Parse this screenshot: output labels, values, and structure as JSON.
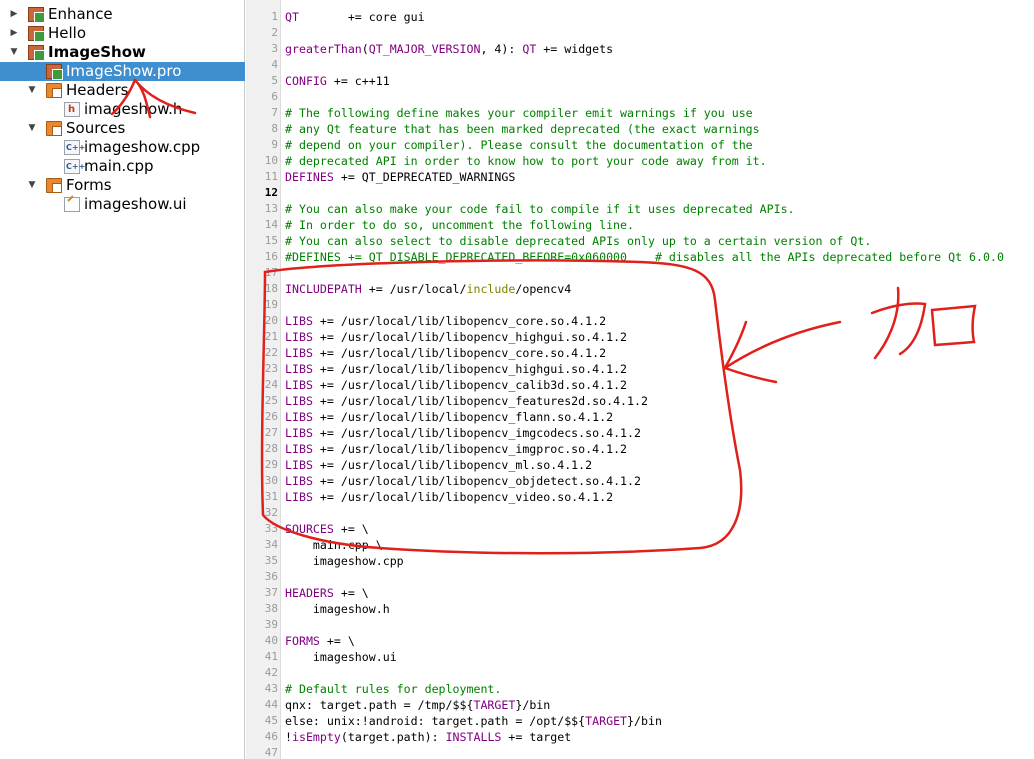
{
  "project_tree": {
    "items": [
      {
        "label": "Enhance",
        "level": 0,
        "icon": "qt-project-icon",
        "state": "collapsed",
        "bold": false,
        "selected": false
      },
      {
        "label": "Hello",
        "level": 0,
        "icon": "qt-project-icon",
        "state": "collapsed",
        "bold": false,
        "selected": false
      },
      {
        "label": "ImageShow",
        "level": 0,
        "icon": "qt-project-icon",
        "state": "expanded",
        "bold": true,
        "selected": false
      },
      {
        "label": "ImageShow.pro",
        "level": 1,
        "icon": "pro-file-icon",
        "state": "leaf",
        "bold": false,
        "selected": true
      },
      {
        "label": "Headers",
        "level": 1,
        "icon": "headers-folder-icon",
        "state": "expanded",
        "bold": false,
        "selected": false
      },
      {
        "label": "imageshow.h",
        "level": 2,
        "icon": "header-file-icon",
        "state": "leaf",
        "bold": false,
        "selected": false
      },
      {
        "label": "Sources",
        "level": 1,
        "icon": "sources-folder-icon",
        "state": "expanded",
        "bold": false,
        "selected": false
      },
      {
        "label": "imageshow.cpp",
        "level": 2,
        "icon": "cpp-file-icon",
        "state": "leaf",
        "bold": false,
        "selected": false
      },
      {
        "label": "main.cpp",
        "level": 2,
        "icon": "cpp-file-icon",
        "state": "leaf",
        "bold": false,
        "selected": false
      },
      {
        "label": "Forms",
        "level": 1,
        "icon": "forms-folder-icon",
        "state": "expanded",
        "bold": false,
        "selected": false
      },
      {
        "label": "imageshow.ui",
        "level": 2,
        "icon": "ui-file-icon",
        "state": "leaf",
        "bold": false,
        "selected": false
      }
    ]
  },
  "editor": {
    "current_line": 12,
    "lines": [
      {
        "n": "1",
        "t": [
          [
            "k",
            "QT"
          ],
          [
            "n",
            "       += core gui"
          ]
        ]
      },
      {
        "n": "2",
        "t": []
      },
      {
        "n": "3",
        "t": [
          [
            "k",
            "greaterThan"
          ],
          [
            "n",
            "("
          ],
          [
            "k",
            "QT_MAJOR_VERSION"
          ],
          [
            "n",
            ", 4): "
          ],
          [
            "k",
            "QT"
          ],
          [
            "n",
            " += widgets"
          ]
        ]
      },
      {
        "n": "4",
        "t": []
      },
      {
        "n": "5",
        "t": [
          [
            "k",
            "CONFIG"
          ],
          [
            "n",
            " += c++11"
          ]
        ]
      },
      {
        "n": "6",
        "t": []
      },
      {
        "n": "7",
        "t": [
          [
            "c",
            "# The following define makes your compiler emit warnings if you use"
          ]
        ]
      },
      {
        "n": "8",
        "t": [
          [
            "c",
            "# any Qt feature that has been marked deprecated (the exact warnings"
          ]
        ]
      },
      {
        "n": "9",
        "t": [
          [
            "c",
            "# depend on your compiler). Please consult the documentation of the"
          ]
        ]
      },
      {
        "n": "10",
        "t": [
          [
            "c",
            "# deprecated API in order to know how to port your code away from it."
          ]
        ]
      },
      {
        "n": "11",
        "t": [
          [
            "k",
            "DEFINES"
          ],
          [
            "n",
            " += QT_DEPRECATED_WARNINGS"
          ]
        ]
      },
      {
        "n": "12",
        "t": []
      },
      {
        "n": "13",
        "t": [
          [
            "c",
            "# You can also make your code fail to compile if it uses deprecated APIs."
          ]
        ]
      },
      {
        "n": "14",
        "t": [
          [
            "c",
            "# In order to do so, uncomment the following line."
          ]
        ]
      },
      {
        "n": "15",
        "t": [
          [
            "c",
            "# You can also select to disable deprecated APIs only up to a certain version of Qt."
          ]
        ]
      },
      {
        "n": "16",
        "t": [
          [
            "c",
            "#DEFINES += QT_DISABLE_DEPRECATED_BEFORE=0x060000    # disables all the APIs deprecated before Qt 6.0.0"
          ]
        ]
      },
      {
        "n": "17",
        "t": []
      },
      {
        "n": "18",
        "t": [
          [
            "k",
            "INCLUDEPATH"
          ],
          [
            "n",
            " += /usr/local/"
          ],
          [
            "m",
            "include"
          ],
          [
            "n",
            "/opencv4"
          ]
        ]
      },
      {
        "n": "19",
        "t": []
      },
      {
        "n": "20",
        "t": [
          [
            "k",
            "LIBS"
          ],
          [
            "n",
            " += /usr/local/lib/libopencv_core.so.4.1.2"
          ]
        ]
      },
      {
        "n": "21",
        "t": [
          [
            "k",
            "LIBS"
          ],
          [
            "n",
            " += /usr/local/lib/libopencv_highgui.so.4.1.2"
          ]
        ]
      },
      {
        "n": "22",
        "t": [
          [
            "k",
            "LIBS"
          ],
          [
            "n",
            " += /usr/local/lib/libopencv_core.so.4.1.2"
          ]
        ]
      },
      {
        "n": "23",
        "t": [
          [
            "k",
            "LIBS"
          ],
          [
            "n",
            " += /usr/local/lib/libopencv_highgui.so.4.1.2"
          ]
        ]
      },
      {
        "n": "24",
        "t": [
          [
            "k",
            "LIBS"
          ],
          [
            "n",
            " += /usr/local/lib/libopencv_calib3d.so.4.1.2"
          ]
        ]
      },
      {
        "n": "25",
        "t": [
          [
            "k",
            "LIBS"
          ],
          [
            "n",
            " += /usr/local/lib/libopencv_features2d.so.4.1.2"
          ]
        ]
      },
      {
        "n": "26",
        "t": [
          [
            "k",
            "LIBS"
          ],
          [
            "n",
            " += /usr/local/lib/libopencv_flann.so.4.1.2"
          ]
        ]
      },
      {
        "n": "27",
        "t": [
          [
            "k",
            "LIBS"
          ],
          [
            "n",
            " += /usr/local/lib/libopencv_imgcodecs.so.4.1.2"
          ]
        ]
      },
      {
        "n": "28",
        "t": [
          [
            "k",
            "LIBS"
          ],
          [
            "n",
            " += /usr/local/lib/libopencv_imgproc.so.4.1.2"
          ]
        ]
      },
      {
        "n": "29",
        "t": [
          [
            "k",
            "LIBS"
          ],
          [
            "n",
            " += /usr/local/lib/libopencv_ml.so.4.1.2"
          ]
        ]
      },
      {
        "n": "30",
        "t": [
          [
            "k",
            "LIBS"
          ],
          [
            "n",
            " += /usr/local/lib/libopencv_objdetect.so.4.1.2"
          ]
        ]
      },
      {
        "n": "31",
        "t": [
          [
            "k",
            "LIBS"
          ],
          [
            "n",
            " += /usr/local/lib/libopencv_video.so.4.1.2"
          ]
        ]
      },
      {
        "n": "32",
        "t": []
      },
      {
        "n": "33",
        "t": [
          [
            "k",
            "SOURCES"
          ],
          [
            "n",
            " += \\"
          ]
        ]
      },
      {
        "n": "34",
        "t": [
          [
            "n",
            "    main.cpp \\"
          ]
        ]
      },
      {
        "n": "35",
        "t": [
          [
            "n",
            "    imageshow.cpp"
          ]
        ]
      },
      {
        "n": "36",
        "t": []
      },
      {
        "n": "37",
        "t": [
          [
            "k",
            "HEADERS"
          ],
          [
            "n",
            " += \\"
          ]
        ]
      },
      {
        "n": "38",
        "t": [
          [
            "n",
            "    imageshow.h"
          ]
        ]
      },
      {
        "n": "39",
        "t": []
      },
      {
        "n": "40",
        "t": [
          [
            "k",
            "FORMS"
          ],
          [
            "n",
            " += \\"
          ]
        ]
      },
      {
        "n": "41",
        "t": [
          [
            "n",
            "    imageshow.ui"
          ]
        ]
      },
      {
        "n": "42",
        "t": []
      },
      {
        "n": "43",
        "t": [
          [
            "c",
            "# Default rules for deployment."
          ]
        ]
      },
      {
        "n": "44",
        "t": [
          [
            "n",
            "qnx: target.path = /tmp/$${"
          ],
          [
            "k",
            "TARGET"
          ],
          [
            "n",
            "}/bin"
          ]
        ]
      },
      {
        "n": "45",
        "t": [
          [
            "n",
            "else: unix:!android: target.path = /opt/$${"
          ],
          [
            "k",
            "TARGET"
          ],
          [
            "n",
            "}/bin"
          ]
        ]
      },
      {
        "n": "46",
        "t": [
          [
            "n",
            "!"
          ],
          [
            "k",
            "isEmpty"
          ],
          [
            "n",
            "(target.path): "
          ],
          [
            "k",
            "INSTALLS"
          ],
          [
            "n",
            " += target"
          ]
        ]
      },
      {
        "n": "47",
        "t": []
      }
    ]
  },
  "colors": {
    "keyword": "#800080",
    "comment": "#008000",
    "builtin": "#808000",
    "selection": "#3f8fd0",
    "annotation": "#e0201b"
  }
}
